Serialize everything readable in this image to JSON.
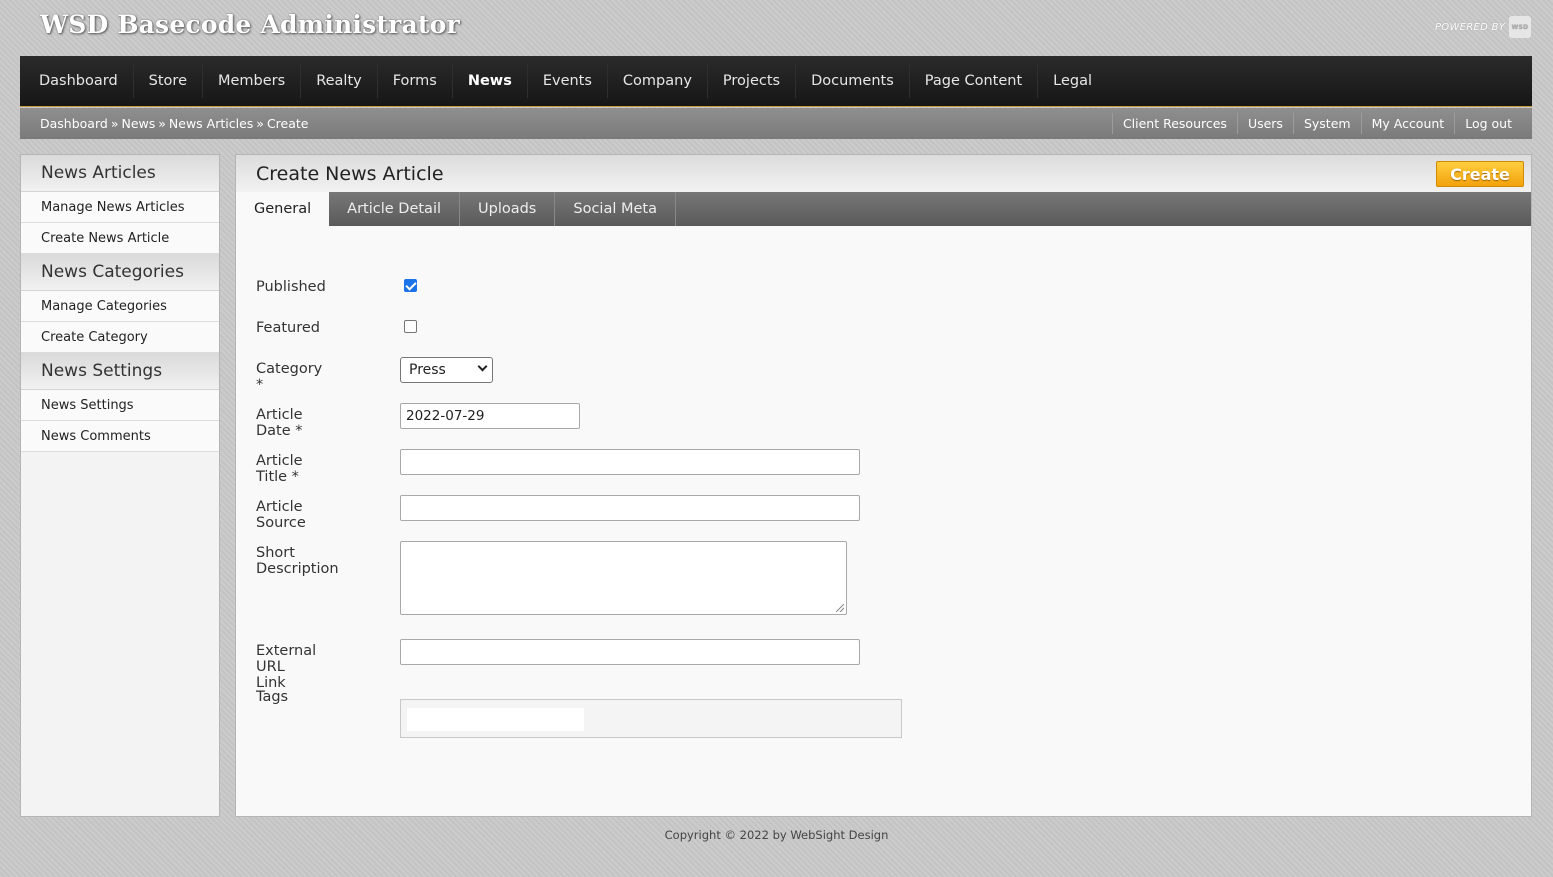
{
  "app": {
    "title": "WSD Basecode Administrator",
    "powered_by": "POWERED BY",
    "powered_logo": "WSD"
  },
  "mainnav": [
    {
      "label": "Dashboard",
      "active": false
    },
    {
      "label": "Store",
      "active": false
    },
    {
      "label": "Members",
      "active": false
    },
    {
      "label": "Realty",
      "active": false
    },
    {
      "label": "Forms",
      "active": false
    },
    {
      "label": "News",
      "active": true
    },
    {
      "label": "Events",
      "active": false
    },
    {
      "label": "Company",
      "active": false
    },
    {
      "label": "Projects",
      "active": false
    },
    {
      "label": "Documents",
      "active": false
    },
    {
      "label": "Page Content",
      "active": false
    },
    {
      "label": "Legal",
      "active": false
    }
  ],
  "breadcrumb": [
    "Dashboard",
    "News",
    "News Articles",
    "Create"
  ],
  "breadcrumb_sep": "»",
  "utility_links": [
    "Client Resources",
    "Users",
    "System",
    "My Account",
    "Log out"
  ],
  "sidebar": {
    "sections": [
      {
        "title": "News Articles",
        "items": [
          "Manage News Articles",
          "Create News Article"
        ]
      },
      {
        "title": "News Categories",
        "items": [
          "Manage Categories",
          "Create Category"
        ]
      },
      {
        "title": "News Settings",
        "items": [
          "News Settings",
          "News Comments"
        ]
      }
    ]
  },
  "panel": {
    "title": "Create News Article",
    "create_label": "Create",
    "tabs": [
      "General",
      "Article Detail",
      "Uploads",
      "Social Meta"
    ],
    "active_tab": "General"
  },
  "form": {
    "published_label": "Published",
    "published_checked": true,
    "featured_label": "Featured",
    "featured_checked": false,
    "category_label": "Category *",
    "category_value": "Press",
    "article_date_label": "Article Date *",
    "article_date_value": "2022-07-29",
    "article_title_label": "Article Title *",
    "article_title_value": "",
    "article_source_label": "Article Source",
    "article_source_value": "",
    "short_description_label": "Short Description",
    "short_description_value": "",
    "external_url_label": "External URL Link",
    "external_url_value": "",
    "tags_label": "Tags"
  },
  "footer": "Copyright © 2022 by WebSight Design",
  "colors": {
    "accent_button": "#f2a20c",
    "active_checkbox": "#1a73e8",
    "nav_bg": "#1c1c1c"
  }
}
